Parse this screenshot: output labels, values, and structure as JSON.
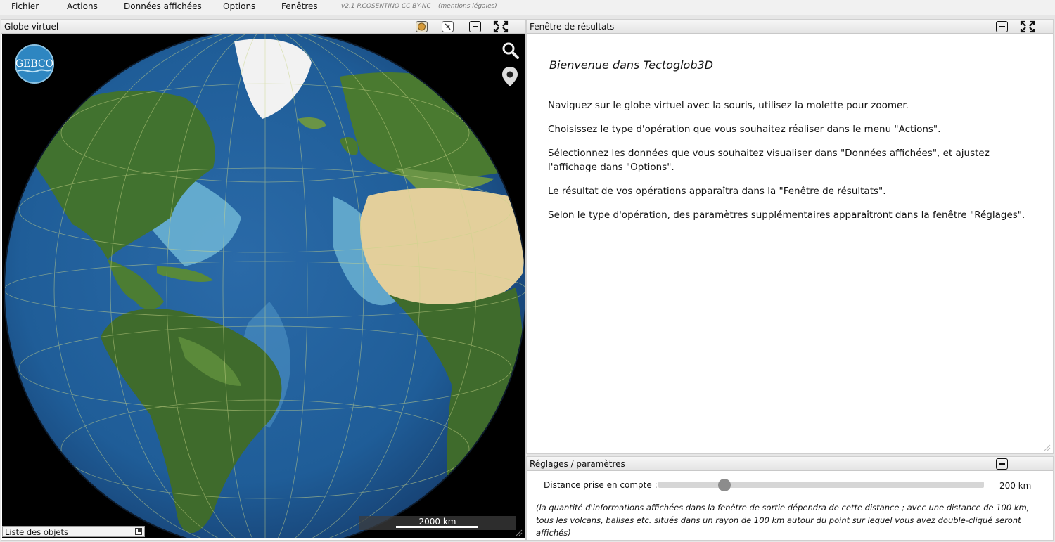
{
  "menu": {
    "items": [
      "Fichier",
      "Actions",
      "Données affichées",
      "Options",
      "Fenêtres"
    ],
    "version": "v2.1 P.COSENTINO CC BY-NC",
    "legal": "(mentions légales)"
  },
  "globe_panel": {
    "title": "Globe virtuel",
    "logo": "GEBCO",
    "scale_label": "2000 km",
    "objects_list_label": "Liste des objets",
    "icons": [
      "globe-layer-icon",
      "satellite-icon",
      "minimize-icon",
      "fullscreen-icon",
      "search-icon",
      "location-pin-icon"
    ]
  },
  "results_panel": {
    "title": "Fenêtre de résultats",
    "welcome": "Bienvenue dans Tectoglob3D",
    "paragraphs": [
      "Naviguez sur le globe virtuel avec la souris, utilisez la molette pour zoomer.",
      "Choisissez le type d'opération que vous souhaitez réaliser dans le menu \"Actions\".",
      "Sélectionnez les données que vous souhaitez visualiser dans \"Données affichées\", et ajustez l'affichage dans \"Options\".",
      "Le résultat de vos opérations apparaîtra dans la \"Fenêtre de résultats\".",
      "Selon le type d'opération, des paramètres supplémentaires apparaîtront dans la fenêtre \"Réglages\"."
    ]
  },
  "settings_panel": {
    "title": "Réglages / paramètres",
    "distance_label": "Distance prise en compte :",
    "distance_value": "200 km",
    "slider_fraction": 0.2,
    "note": "(la quantité d'informations affichées dans la fenêtre de sortie dépendra de cette distance ; avec une distance de 100 km, tous les volcans, balises etc. situés dans un rayon de 100 km autour du point sur lequel vous avez double-cliqué seront affichés)"
  },
  "colors": {
    "ocean_deep": "#1f5d98",
    "ocean_shelf": "#7cc3df",
    "land_green": "#3f6b2c",
    "desert": "#e6d3a0",
    "ice": "#f2f2f2"
  }
}
